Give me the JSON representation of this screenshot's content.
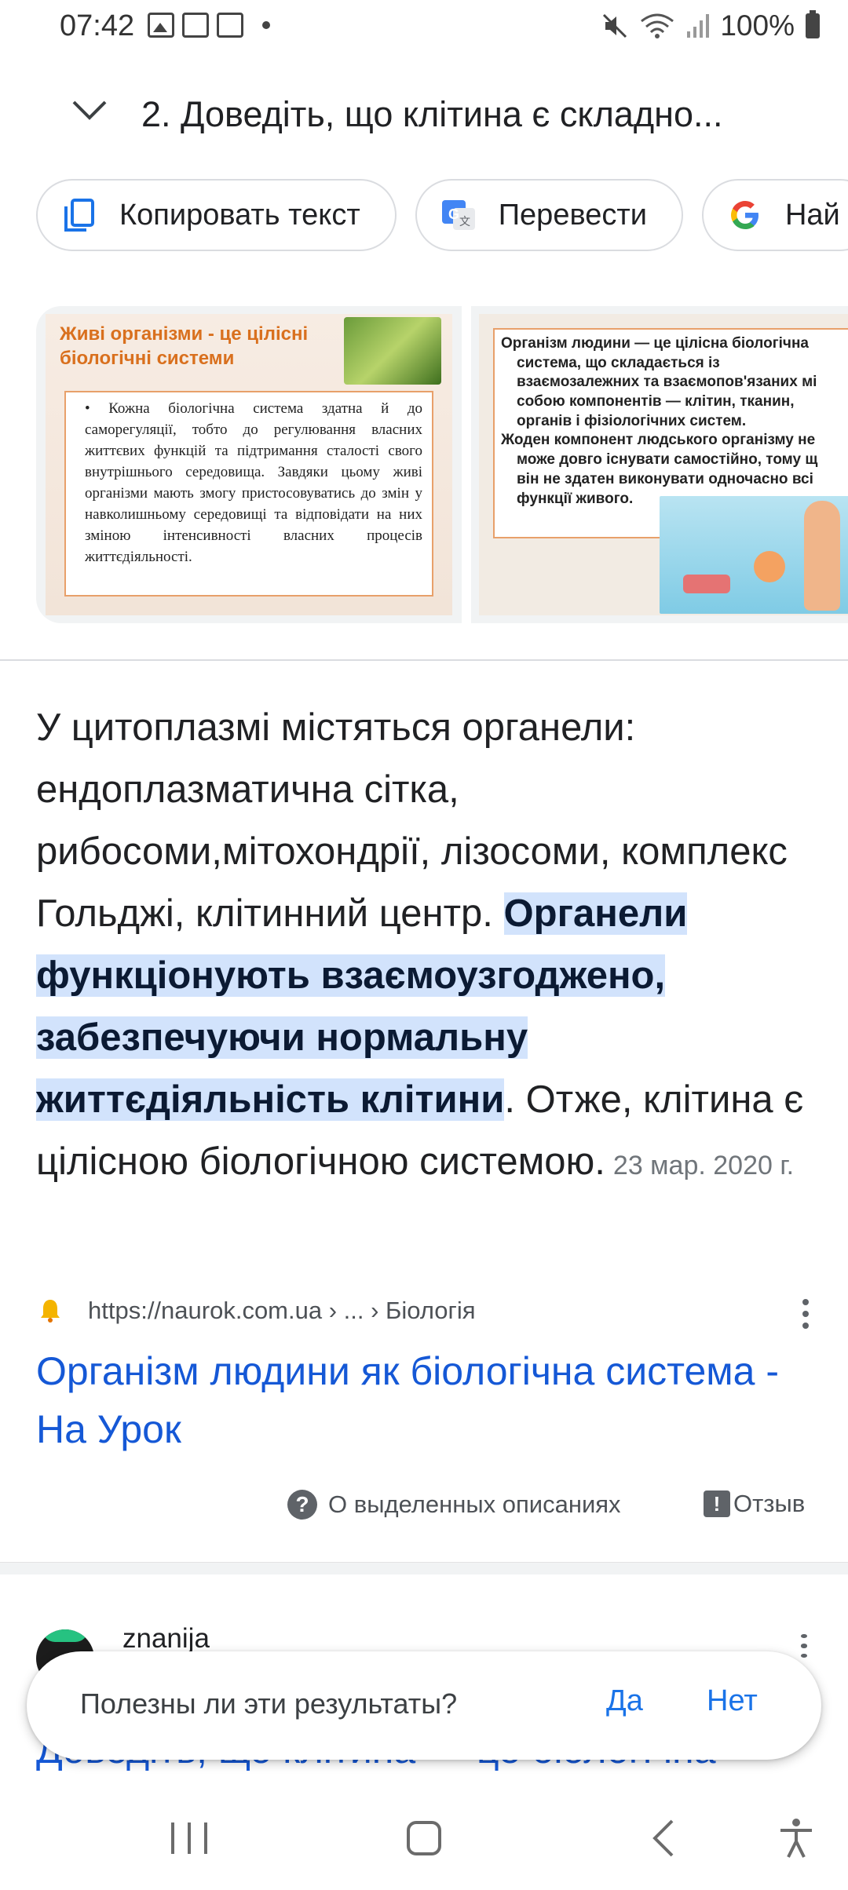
{
  "status_bar": {
    "time": "07:42",
    "battery": "100%"
  },
  "header": {
    "title": "2. Доведіть, що клітина є складно..."
  },
  "chips": [
    {
      "label": "Копировать текст",
      "icon": "copy-icon"
    },
    {
      "label": "Перевести",
      "icon": "translate-icon"
    },
    {
      "label": "Най",
      "icon": "google-icon"
    }
  ],
  "images": {
    "slide1": {
      "title": "Живі організми - це цілісні біологічні системи",
      "text": "• Кожна біологічна система здатна й до саморегуляції, тобто до регулювання власних життєвих функцій та підтримання сталості свого внутрішнього середовища. Завдяки цьому живі організми мають змогу пристосовуватись до змін у навколишньому середовищі та відповідати на них зміною інтенсивності власних процесів життєдіяльності."
    },
    "slide2": {
      "line1": "Організм людини — це цілісна біологічна",
      "line2": "система, що складається із",
      "line3": "взаємозалежних та взаємопов'язаних мі",
      "line4": "собою компонентів — клітин, тканин,",
      "line5": "органів і фізіологічних систем.",
      "line6": "Жоден компонент людського організму не",
      "line7": "може довго існувати самостійно, тому щ",
      "line8": "він не здатен виконувати одночасно всі",
      "line9": "функції живого."
    }
  },
  "snippet": {
    "text_before": "У цитоплазмі містяться органели: ендоплазматична сітка, рибосоми,мітохондрії, лізосоми, комплекс Гольджі, клітинний центр. ",
    "highlight": "Органели функціонують взаємоузгоджено, забезпечуючи нормальну життєдіяльність клітини",
    "text_after": ". Отже, клітина є цілісною біологічною системою.",
    "date": "23 мар. 2020 г."
  },
  "source": {
    "url": "https://naurok.com.ua › ... › Біологія",
    "title": "Організм людини як біологічна система - На Урок"
  },
  "footer_links": {
    "about": "О выделенных описаниях",
    "feedback": "Отзыв"
  },
  "next_result": {
    "site": "znanija",
    "title": "Доведіть, що клітина — це біологічна"
  },
  "popup": {
    "question": "Полезны ли эти результаты?",
    "yes": "Да",
    "no": "Нет"
  },
  "colors": {
    "link": "#1558d6",
    "highlight": "#d2e3fc",
    "accent": "#1a73e8"
  }
}
